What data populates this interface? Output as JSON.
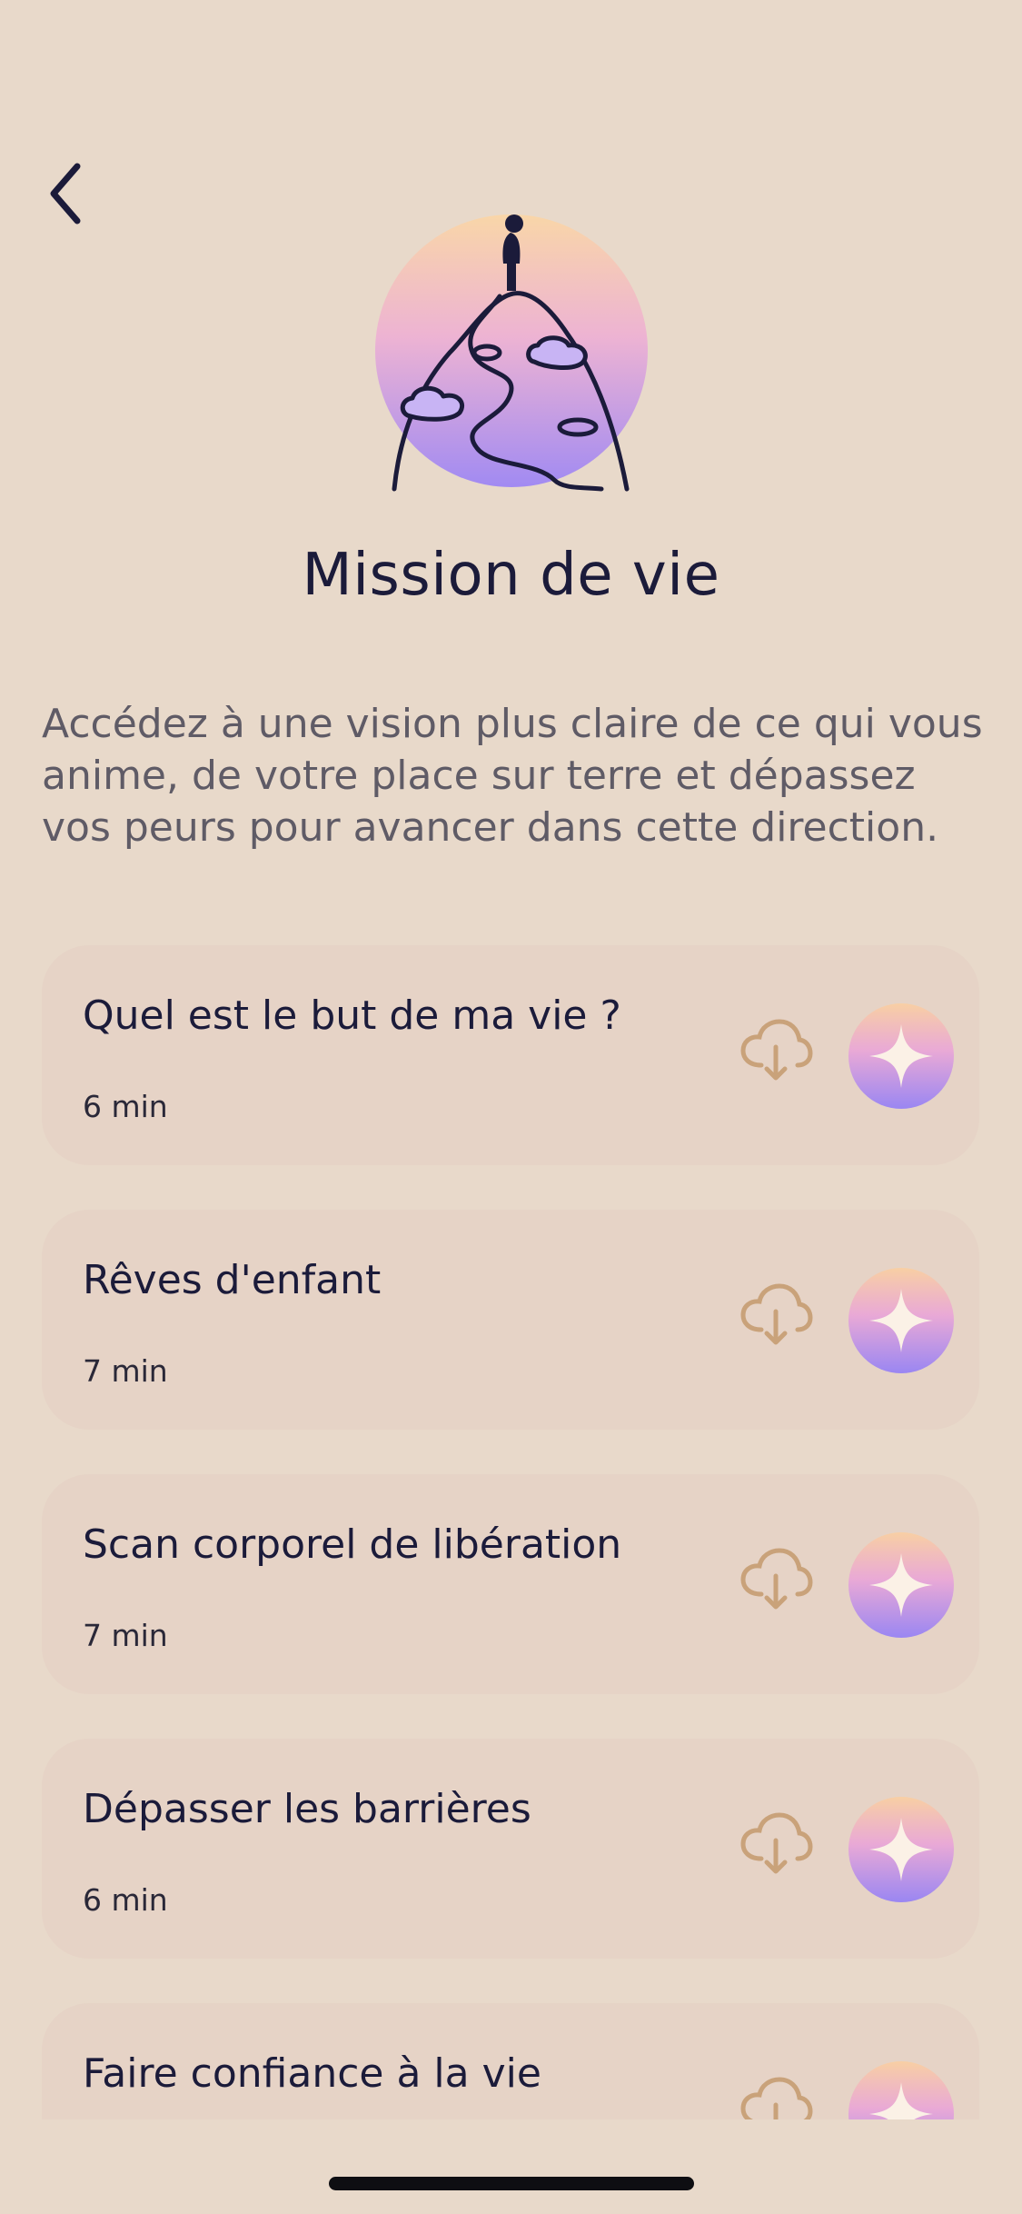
{
  "header": {
    "back_icon": "chevron-left-icon"
  },
  "hero": {
    "illustration": "person-on-mountain-illustration"
  },
  "title": "Mission de vie",
  "description": "Accédez à une vision plus claire de ce qui vous anime, de votre place sur terre et dépassez vos peurs pour avancer dans cette direction.",
  "sessions": [
    {
      "title": "Quel est le but de ma vie ?",
      "duration": "6 min"
    },
    {
      "title": "Rêves d'enfant",
      "duration": "7 min"
    },
    {
      "title": "Scan corporel de libération",
      "duration": "7 min"
    },
    {
      "title": "Dépasser les barrières",
      "duration": "6 min"
    },
    {
      "title": "Faire confiance à la vie",
      "duration": ""
    }
  ],
  "icons": {
    "download": "cloud-download-icon",
    "play": "sparkle-play-icon"
  },
  "colors": {
    "background": "#E8D9CA",
    "card": "#E6D3C6",
    "text": "#1B1B3A",
    "muted_text": "#5F5B66",
    "download_icon": "#C9A27A",
    "gradient_top": "#F8CFA4",
    "gradient_mid": "#E9A9D6",
    "gradient_bottom": "#9A86F2"
  }
}
